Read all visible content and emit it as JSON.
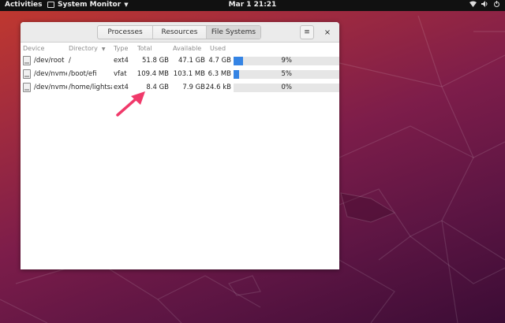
{
  "topbar": {
    "activities": "Activities",
    "app_name": "System Monitor",
    "clock": "Mar 1  21:21"
  },
  "tabs": [
    {
      "label": "Processes",
      "active": false
    },
    {
      "label": "Resources",
      "active": false
    },
    {
      "label": "File Systems",
      "active": true
    }
  ],
  "menu_button": {
    "icon": "hamburger-icon",
    "glyph": "≡"
  },
  "close_button": {
    "icon": "close-icon",
    "glyph": "×"
  },
  "columns": [
    "Device",
    "Directory",
    "Type",
    "Total",
    "Available",
    "Used"
  ],
  "filesystems": [
    {
      "device": "/dev/root",
      "directory": "/",
      "type": "ext4",
      "total": "51.8 GB",
      "available": "47.1 GB",
      "used": "4.7 GB",
      "percent_label": "9%",
      "percent": 9
    },
    {
      "device": "/dev/nvme",
      "directory": "/boot/efi",
      "type": "vfat",
      "total": "109.4 MB",
      "available": "103.1 MB",
      "used": "6.3 MB",
      "percent_label": "5%",
      "percent": 5
    },
    {
      "device": "/dev/nvme",
      "directory": "/home/lightsai",
      "type": "ext4",
      "total": "8.4 GB",
      "available": "7.9 GB",
      "used": "24.6 kB",
      "percent_label": "0%",
      "percent": 0
    }
  ],
  "colors": {
    "accent": "#3584e4",
    "annotation_arrow": "#f0396a"
  }
}
